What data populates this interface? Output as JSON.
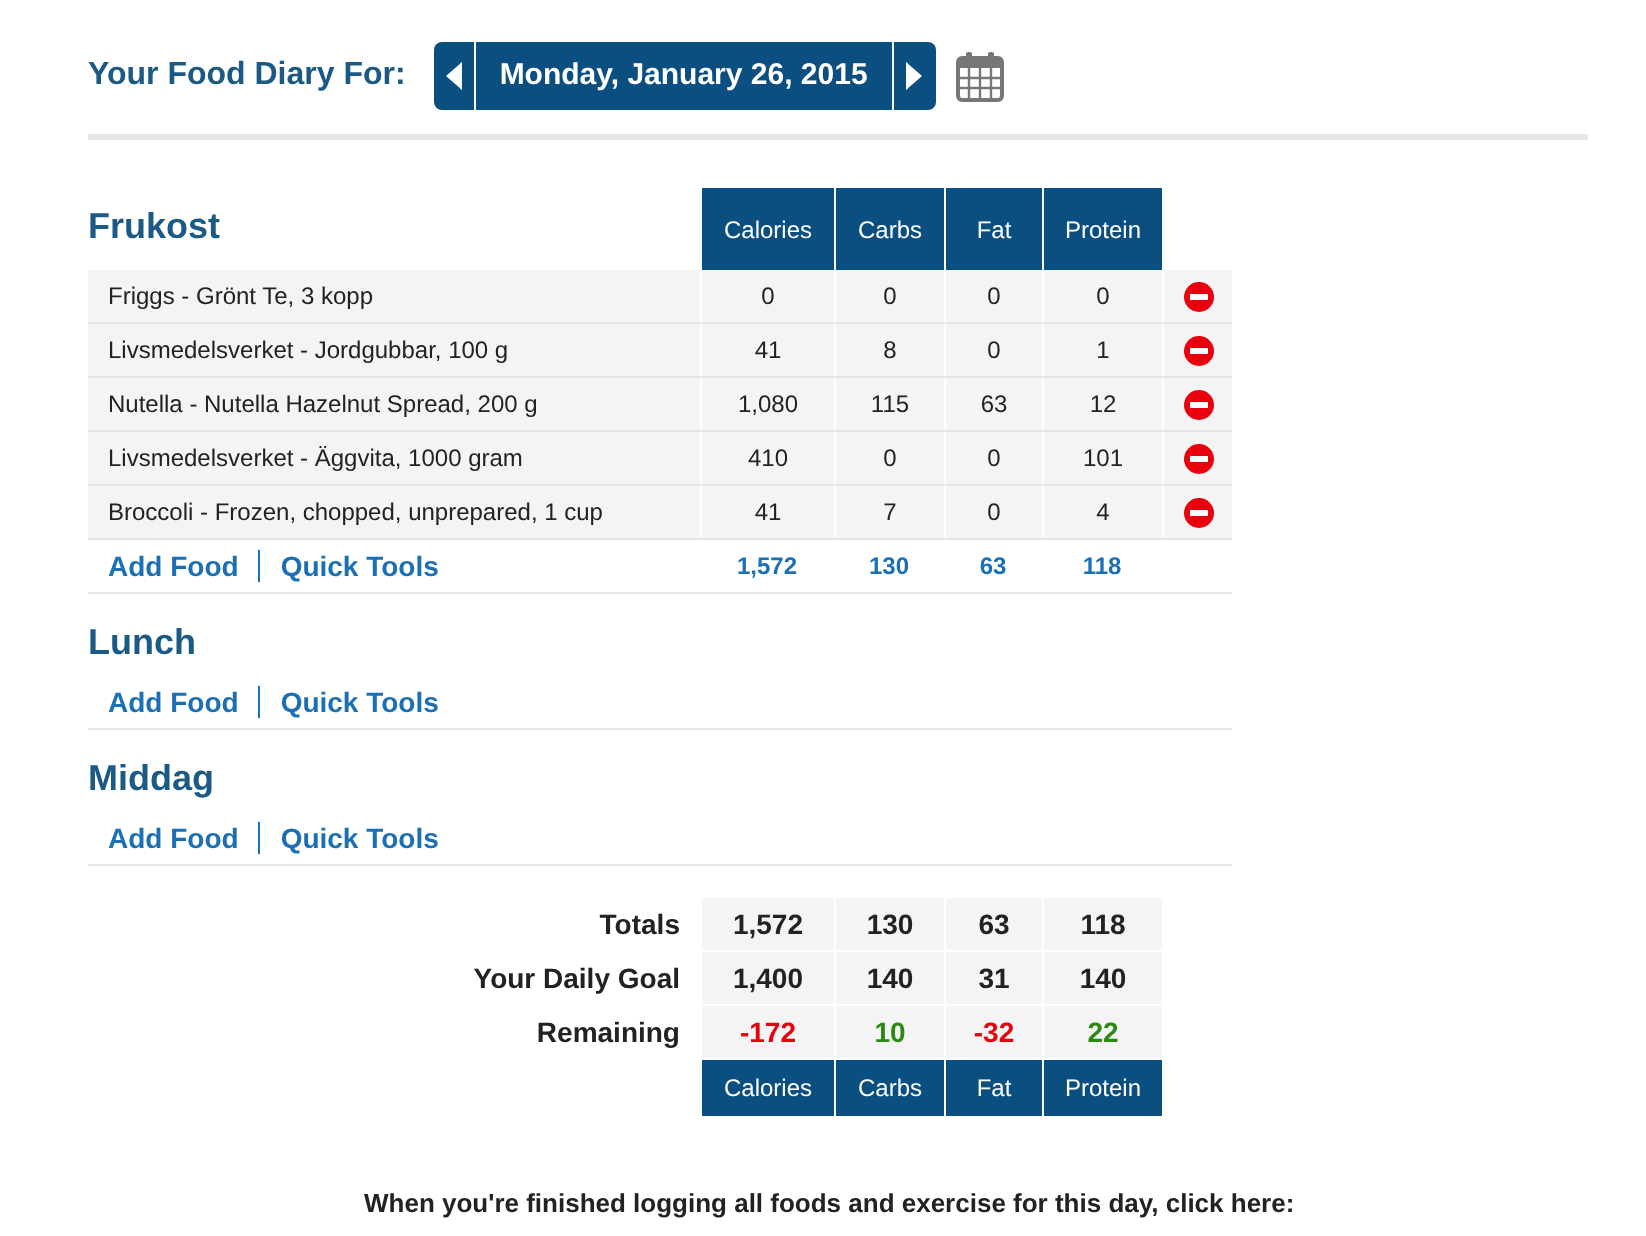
{
  "header": {
    "title": "Your Food Diary For:",
    "date": "Monday, January 26, 2015"
  },
  "columns": [
    "Calories",
    "Carbs",
    "Fat",
    "Protein"
  ],
  "meals": [
    {
      "name": "Frukost",
      "foods": [
        {
          "name": "Friggs - Grönt Te, 3 kopp",
          "values": [
            "0",
            "0",
            "0",
            "0"
          ]
        },
        {
          "name": "Livsmedelsverket - Jordgubbar, 100 g",
          "values": [
            "41",
            "8",
            "0",
            "1"
          ]
        },
        {
          "name": "Nutella - Nutella Hazelnut Spread, 200 g",
          "values": [
            "1,080",
            "115",
            "63",
            "12"
          ]
        },
        {
          "name": "Livsmedelsverket - Äggvita, 1000 gram",
          "values": [
            "410",
            "0",
            "0",
            "101"
          ]
        },
        {
          "name": "Broccoli - Frozen, chopped, unprepared, 1 cup",
          "values": [
            "41",
            "7",
            "0",
            "4"
          ]
        }
      ],
      "add_food": "Add Food",
      "quick_tools": "Quick Tools",
      "totals": [
        "1,572",
        "130",
        "63",
        "118"
      ]
    },
    {
      "name": "Lunch",
      "add_food": "Add Food",
      "quick_tools": "Quick Tools"
    },
    {
      "name": "Middag",
      "add_food": "Add Food",
      "quick_tools": "Quick Tools"
    }
  ],
  "summary": [
    {
      "label": "Totals",
      "values": [
        {
          "text": "1,572"
        },
        {
          "text": "130"
        },
        {
          "text": "63"
        },
        {
          "text": "118"
        }
      ]
    },
    {
      "label": "Your Daily Goal",
      "values": [
        {
          "text": "1,400"
        },
        {
          "text": "140"
        },
        {
          "text": "31"
        },
        {
          "text": "140"
        }
      ]
    },
    {
      "label": "Remaining",
      "values": [
        {
          "text": "-172",
          "over": true
        },
        {
          "text": "10",
          "over": false
        },
        {
          "text": "-32",
          "over": true
        },
        {
          "text": "22",
          "over": false
        }
      ]
    }
  ],
  "summary_columns": [
    "Calories",
    "Carbs",
    "Fat",
    "Protein"
  ],
  "footer_note": "When you're finished logging all foods and exercise for this day, click here:"
}
